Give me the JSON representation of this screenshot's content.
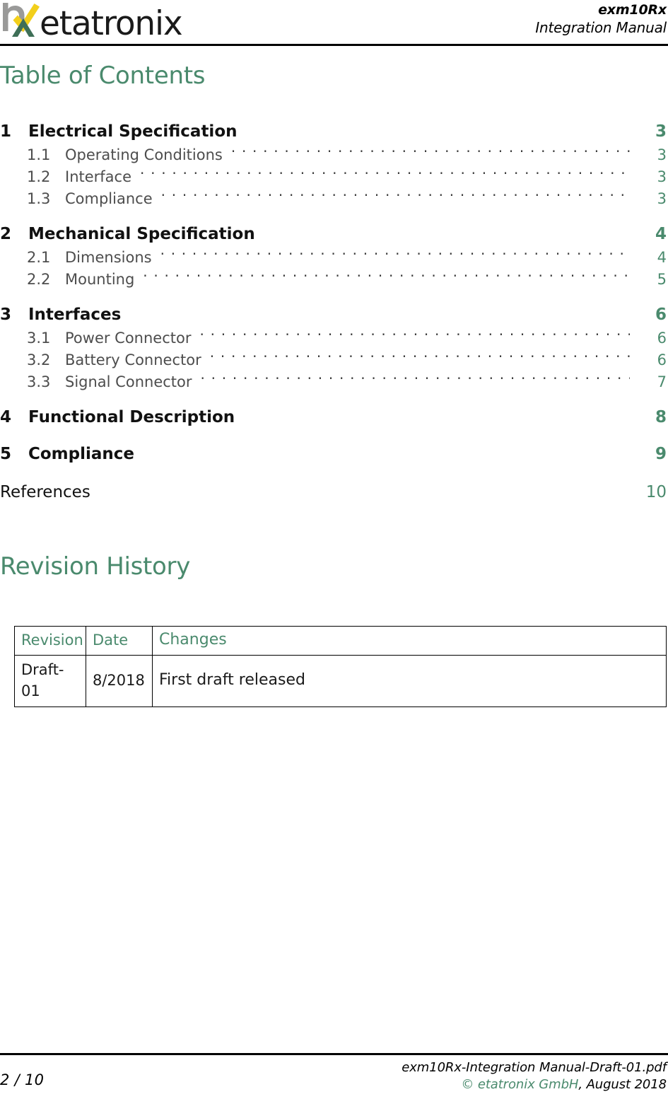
{
  "header": {
    "logo_word": "etatronix",
    "logo_icon": "etatronix-logo-mark",
    "product": "exm10Rx",
    "subtitle": "Integration Manual",
    "colors": {
      "logo_gray": "#9a9a99",
      "logo_yellow": "#f2cf1b",
      "logo_green": "#3e6f57"
    }
  },
  "toc": {
    "title": "Table of Contents",
    "entries": [
      {
        "kind": "chapter",
        "number": "1",
        "label": "Electrical Specification",
        "page": "3",
        "leader": false
      },
      {
        "kind": "section",
        "number": "1.1",
        "label": "Operating Conditions",
        "page": "3",
        "leader": true
      },
      {
        "kind": "section",
        "number": "1.2",
        "label": "Interface",
        "page": "3",
        "leader": true
      },
      {
        "kind": "section",
        "number": "1.3",
        "label": "Compliance",
        "page": "3",
        "leader": true
      },
      {
        "kind": "chapter",
        "number": "2",
        "label": "Mechanical Specification",
        "page": "4",
        "leader": false
      },
      {
        "kind": "section",
        "number": "2.1",
        "label": "Dimensions",
        "page": "4",
        "leader": true
      },
      {
        "kind": "section",
        "number": "2.2",
        "label": "Mounting",
        "page": "5",
        "leader": true
      },
      {
        "kind": "chapter",
        "number": "3",
        "label": "Interfaces",
        "page": "6",
        "leader": false
      },
      {
        "kind": "section",
        "number": "3.1",
        "label": "Power Connector",
        "page": "6",
        "leader": true
      },
      {
        "kind": "section",
        "number": "3.2",
        "label": "Battery Connector",
        "page": "6",
        "leader": true
      },
      {
        "kind": "section",
        "number": "3.3",
        "label": "Signal Connector",
        "page": "7",
        "leader": true
      },
      {
        "kind": "chapter",
        "number": "4",
        "label": "Functional Description",
        "page": "8",
        "leader": false
      },
      {
        "kind": "chapter",
        "number": "5",
        "label": "Compliance",
        "page": "9",
        "leader": false
      },
      {
        "kind": "unnumbered",
        "number": "",
        "label": "References",
        "page": "10",
        "leader": false
      }
    ]
  },
  "revision_history": {
    "title": "Revision History",
    "columns": [
      "Revision",
      "Date",
      "Changes"
    ],
    "rows": [
      {
        "revision": "Draft-01",
        "date": "8/2018",
        "changes": "First draft released"
      }
    ]
  },
  "footer": {
    "page_indicator": "2 / 10",
    "filename": "exm10Rx-Integration Manual-Draft-01.pdf",
    "copyright_green": "© etatronix GmbH",
    "copyright_rest": ", August 2018"
  },
  "theme": {
    "accent_green": "#4a8a6d",
    "rule_black": "#000000"
  }
}
